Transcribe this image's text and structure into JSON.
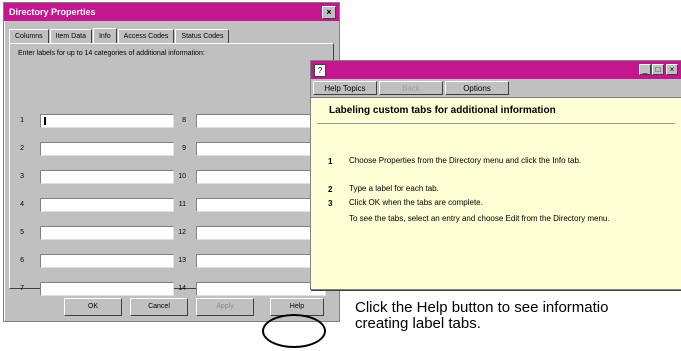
{
  "dialog": {
    "title": "Directory Properties",
    "close_label": "×",
    "tabs": [
      "Columns",
      "Item Data",
      "Info",
      "Access Codes",
      "Status Codes"
    ],
    "active_tab_index": 2,
    "instruction": "Enter labels for up to 14 categories of additional information:",
    "row_numbers": [
      "1",
      "2",
      "3",
      "4",
      "5",
      "6",
      "7",
      "8",
      "9",
      "10",
      "11",
      "12",
      "13",
      "14"
    ],
    "buttons": {
      "ok": "OK",
      "cancel": "Cancel",
      "apply": "Apply",
      "help": "Help"
    }
  },
  "help_window": {
    "title_icon": "?",
    "window_buttons": [
      "_",
      "□",
      "×"
    ],
    "toolbar": {
      "help_topics": "Help Topics",
      "back": "Back",
      "options": "Options"
    },
    "heading": "Labeling custom tabs for additional information",
    "steps": [
      {
        "number": "1",
        "text": "Choose Properties from the Directory menu and click the Info tab."
      },
      {
        "number": "2",
        "text": "Type a label for each tab."
      },
      {
        "number": "3",
        "text": "Click OK when the tabs are complete."
      }
    ],
    "note": "To see the tabs, select an entry and choose Edit from the Directory menu."
  },
  "caption": {
    "line1": "Click the Help button to see informatio",
    "line2": "creating label tabs."
  },
  "colors": {
    "title_bar": "#c4168e",
    "help_background": "#ffffd6",
    "dialog_face": "#c0c0c0"
  }
}
